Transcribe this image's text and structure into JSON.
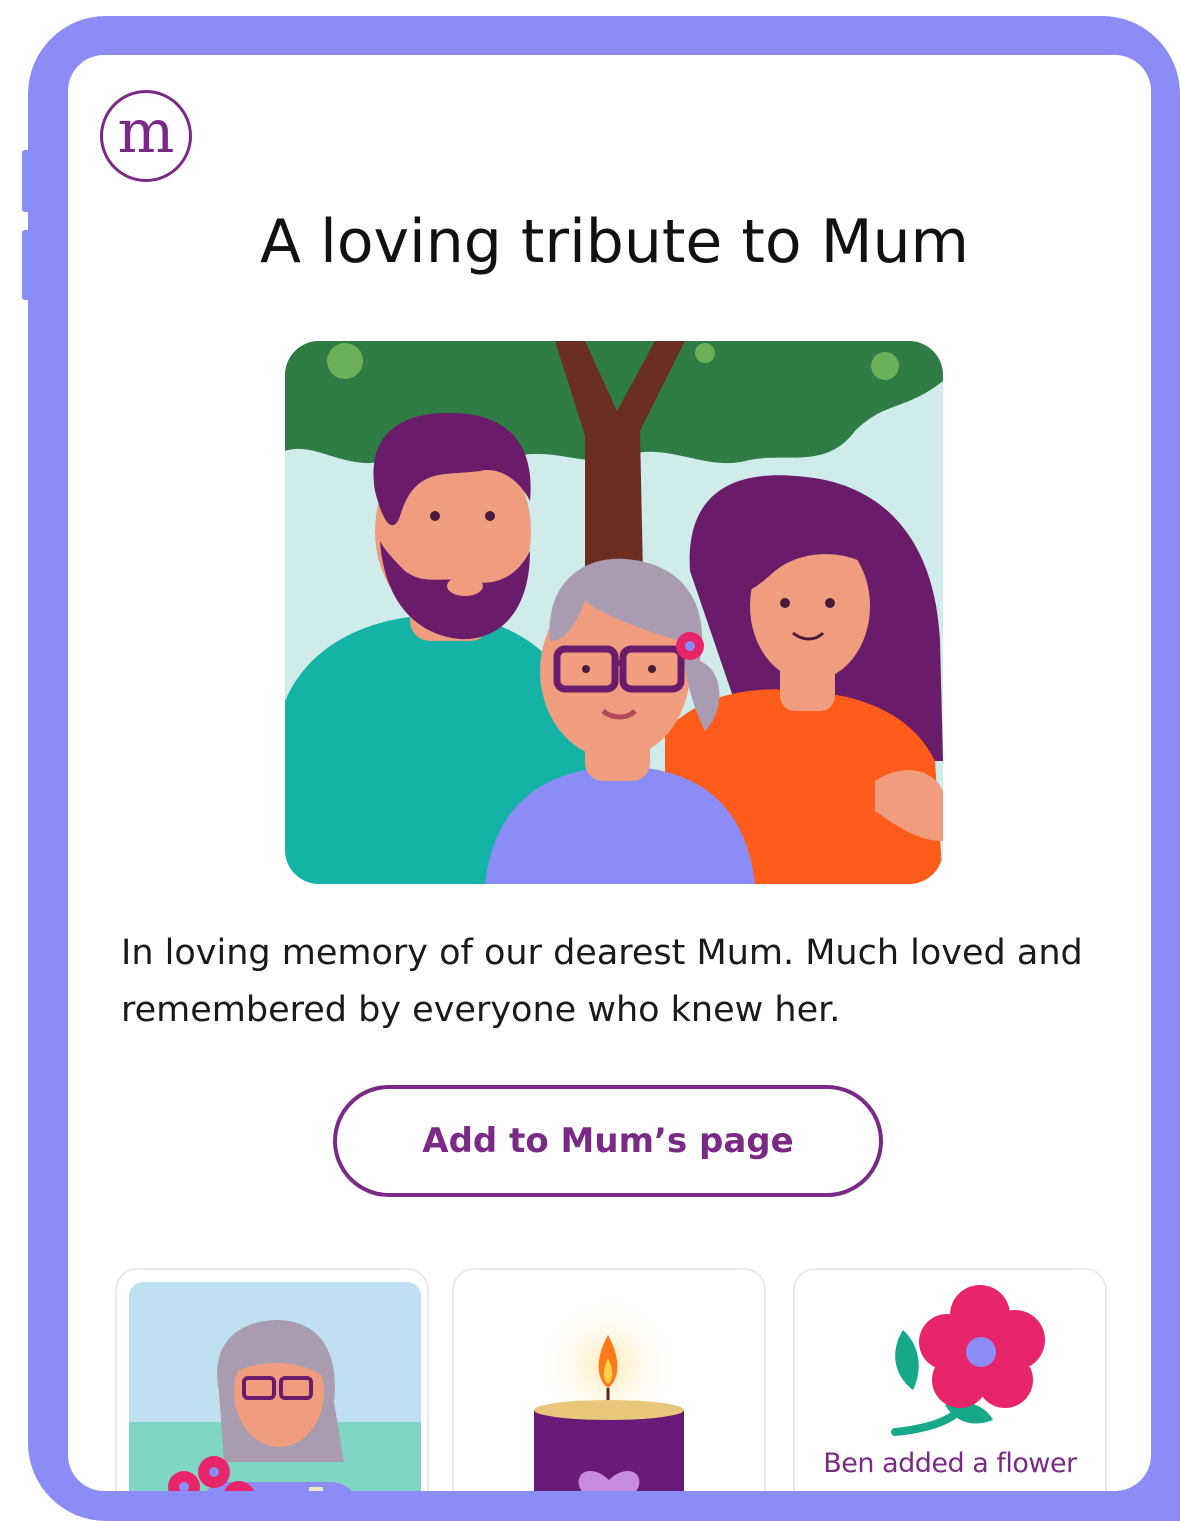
{
  "logo": {
    "letter": "m"
  },
  "page": {
    "title": "A loving tribute to Mum",
    "description": "In loving memory of our dearest Mum. Much loved and remembered by everyone who knew her."
  },
  "actions": {
    "add_label": "Add to Mum’s page"
  },
  "cards": {
    "photo_icon": "photo-icon",
    "candle_icon": "candle-icon",
    "flower_icon": "flower-icon",
    "flower_label": "Ben added a flower"
  },
  "colors": {
    "frame": "#8c8cf7",
    "brand_purple": "#7a2a86",
    "text": "#1a1a1a"
  }
}
